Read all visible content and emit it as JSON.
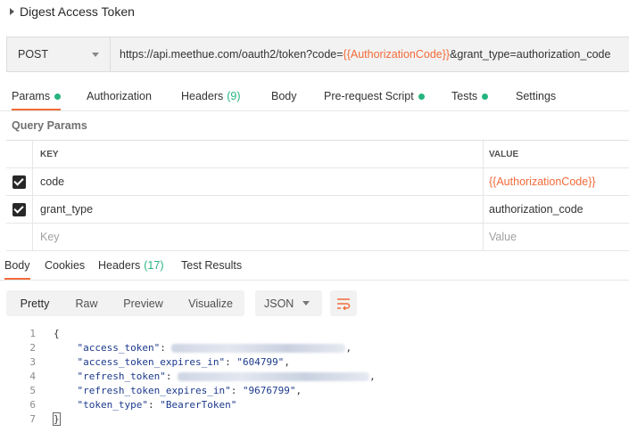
{
  "title": "Digest Access Token",
  "request": {
    "method": "POST",
    "url_prefix": "https://api.meethue.com/oauth2/token?code=",
    "url_variable": "{{AuthorizationCode}}",
    "url_suffix": "&grant_type=authorization_code"
  },
  "request_tabs": [
    {
      "label": "Params",
      "dot": true
    },
    {
      "label": "Authorization"
    },
    {
      "label": "Headers",
      "count": "(9)"
    },
    {
      "label": "Body"
    },
    {
      "label": "Pre-request Script",
      "dot": true
    },
    {
      "label": "Tests",
      "dot": true
    },
    {
      "label": "Settings"
    }
  ],
  "query_params": {
    "label": "Query Params",
    "headers": {
      "key": "KEY",
      "value": "VALUE"
    },
    "rows": [
      {
        "checked": true,
        "key": "code",
        "value": "{{AuthorizationCode}}"
      },
      {
        "checked": true,
        "key": "grant_type",
        "value": "authorization_code"
      }
    ],
    "placeholder": {
      "key": "Key",
      "value": "Value"
    }
  },
  "response_tabs": [
    {
      "label": "Body"
    },
    {
      "label": "Cookies"
    },
    {
      "label": "Headers",
      "count": "(17)"
    },
    {
      "label": "Test Results"
    }
  ],
  "view_modes": [
    "Pretty",
    "Raw",
    "Preview",
    "Visualize"
  ],
  "format": "JSON",
  "response_body": {
    "line_numbers": [
      "1",
      "2",
      "3",
      "4",
      "5",
      "6",
      "7"
    ],
    "open_brace": "{",
    "close_brace": "}",
    "keys": [
      "\"access_token\"",
      "\"access_token_expires_in\"",
      "\"refresh_token\"",
      "\"refresh_token_expires_in\"",
      "\"token_type\""
    ],
    "values": [
      "",
      "\"604799\"",
      "",
      "\"9676799\"",
      "\"BearerToken\""
    ]
  },
  "colors": {
    "accent": "#f26b3a",
    "dot": "#26b47f"
  }
}
